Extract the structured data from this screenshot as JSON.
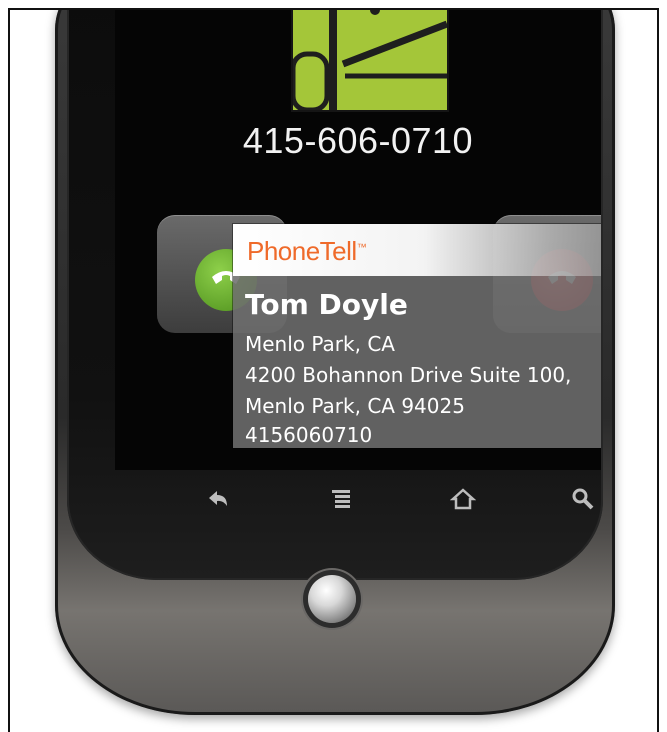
{
  "incoming_call": {
    "phone_number": "415-606-0710"
  },
  "popup": {
    "brand_name": "PhoneTell",
    "brand_mark": "™",
    "brand_color": "#ef6a2a",
    "contact_name": "Tom Doyle",
    "location": "Menlo Park, CA",
    "address_line_1": "4200 Bohannon Drive Suite 100,",
    "address_line_2": "Menlo Park, CA 94025",
    "phone_digits": "4156060710"
  },
  "call_actions": {
    "answer_icon": "answer-phone-icon",
    "answer_color": "#6fbf2f",
    "decline_icon": "decline-phone-icon",
    "decline_color": "#e0303c"
  },
  "nav_bar": {
    "icons": [
      "back-icon",
      "menu-icon",
      "home-icon",
      "search-icon"
    ]
  },
  "avatar": {
    "icon": "android-robot-icon",
    "color": "#a4c639"
  }
}
